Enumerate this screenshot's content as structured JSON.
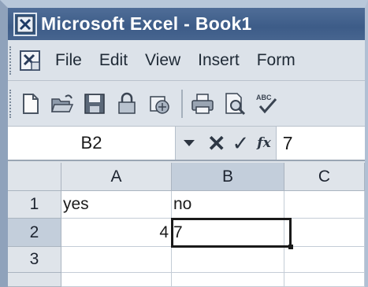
{
  "window": {
    "title": "Microsoft Excel - Book1",
    "colors": {
      "title_bar": "#3d5c88",
      "title_text": "#ffffff"
    }
  },
  "menu": {
    "items": [
      {
        "label": "File"
      },
      {
        "label": "Edit"
      },
      {
        "label": "View"
      },
      {
        "label": "Insert"
      },
      {
        "label": "Form"
      }
    ]
  },
  "toolbar": {
    "icons": [
      "new-document-icon",
      "open-folder-icon",
      "save-icon",
      "permission-icon",
      "email-icon",
      "print-icon",
      "print-preview-icon",
      "spelling-icon"
    ]
  },
  "formula_bar": {
    "name_box": "B2",
    "fx_label": "fx",
    "content": "7"
  },
  "sheet": {
    "columns": [
      "A",
      "B",
      "C"
    ],
    "rows": [
      "1",
      "2",
      "3"
    ],
    "cells": {
      "A1": "yes",
      "B1": "no",
      "A2": "4",
      "B2": "7"
    },
    "active_cell": "B2"
  }
}
